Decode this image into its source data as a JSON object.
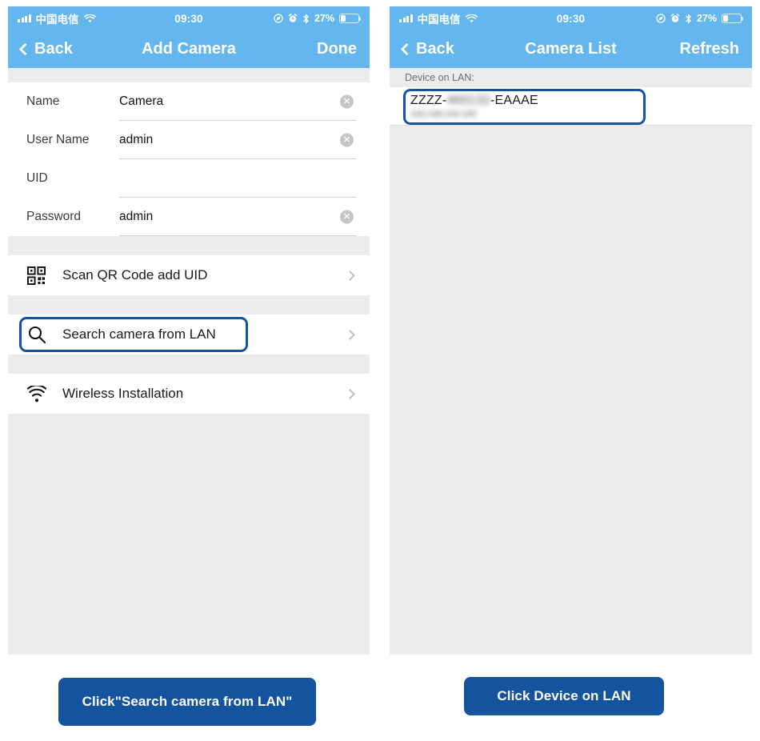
{
  "left_phone": {
    "status_bar": {
      "carrier": "中国电信",
      "time": "09:30",
      "battery_percent": "27%",
      "icons": [
        "signal-bars-icon",
        "wifi-icon",
        "location-icon",
        "alarm-clock-icon",
        "bluetooth-icon",
        "battery-icon"
      ]
    },
    "nav": {
      "back_label": "Back",
      "title": "Add Camera",
      "action_label": "Done"
    },
    "form": {
      "fields": [
        {
          "label": "Name",
          "value": "Camera",
          "has_clear": true
        },
        {
          "label": "User Name",
          "value": "admin",
          "has_clear": true
        },
        {
          "label": "UID",
          "value": "",
          "has_clear": false
        },
        {
          "label": "Password",
          "value": "admin",
          "has_clear": true
        }
      ]
    },
    "menu_rows": [
      {
        "label": "Scan QR Code add UID",
        "icon": "qr-code-icon",
        "highlighted": false
      },
      {
        "label": "Search camera from LAN",
        "icon": "search-icon",
        "highlighted": true
      },
      {
        "label": "Wireless Installation",
        "icon": "wifi-icon",
        "highlighted": false
      }
    ]
  },
  "right_phone": {
    "status_bar": {
      "carrier": "中国电信",
      "time": "09:30",
      "battery_percent": "27%"
    },
    "nav": {
      "back_label": "Back",
      "title": "Camera List",
      "action_label": "Refresh"
    },
    "section_header": "Device on LAN:",
    "device": {
      "uid_prefix": "ZZZZ-",
      "uid_middle_blurred": "460132",
      "uid_suffix": "-EAAAE",
      "ip_blurred": "192.168.100.100",
      "highlighted": true
    }
  },
  "captions": {
    "left_button": "Click\"Search camera from LAN\"",
    "right_button": "Click Device on LAN"
  },
  "colors": {
    "header_blue": "#63b6ee",
    "accent_navy": "#14539d",
    "section_gray": "#ececec",
    "panel_white": "#ffffff"
  }
}
